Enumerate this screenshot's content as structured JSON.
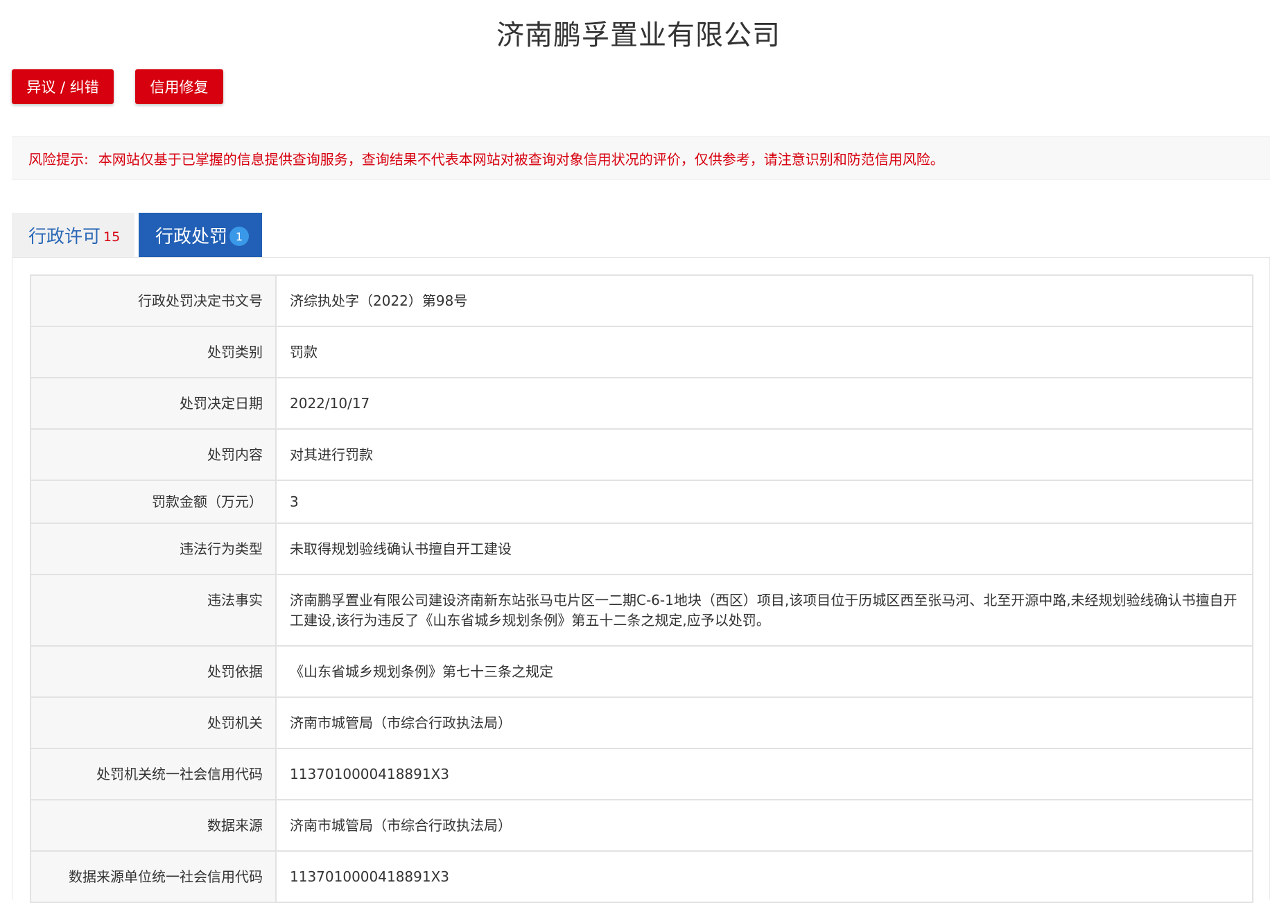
{
  "page": {
    "title": "济南鹏孚置业有限公司"
  },
  "actions": {
    "dispute_label": "异议 / 纠错",
    "repair_label": "信用修复"
  },
  "risk": {
    "label": "风险提示:",
    "text": "本网站仅基于已掌握的信息提供查询服务，查询结果不代表本网站对被查询对象信用状况的评价，仅供参考，请注意识别和防范信用风险。"
  },
  "tabs": [
    {
      "label": "行政许可",
      "count": "15",
      "active": false
    },
    {
      "label": "行政处罚",
      "count": "1",
      "active": true
    }
  ],
  "record": [
    {
      "key": "行政处罚决定书文号",
      "value": "济综执处字（2022）第98号"
    },
    {
      "key": "处罚类别",
      "value": "罚款"
    },
    {
      "key": "处罚决定日期",
      "value": "2022/10/17"
    },
    {
      "key": "处罚内容",
      "value": "对其进行罚款"
    },
    {
      "key": "罚款金额（万元）",
      "value": "3"
    },
    {
      "key": "违法行为类型",
      "value": "未取得规划验线确认书擅自开工建设"
    },
    {
      "key": "违法事实",
      "value": "济南鹏孚置业有限公司建设济南新东站张马屯片区一二期C-6-1地块（西区）项目,该项目位于历城区西至张马河、北至开源中路,未经规划验线确认书擅自开工建设,该行为违反了《山东省城乡规划条例》第五十二条之规定,应予以处罚。"
    },
    {
      "key": "处罚依据",
      "value": "《山东省城乡规划条例》第七十三条之规定"
    },
    {
      "key": "处罚机关",
      "value": "济南市城管局（市综合行政执法局）"
    },
    {
      "key": "处罚机关统一社会信用代码",
      "value": "1137010000418891X3"
    },
    {
      "key": "数据来源",
      "value": "济南市城管局（市综合行政执法局）"
    },
    {
      "key": "数据来源单位统一社会信用代码",
      "value": "1137010000418891X3"
    }
  ],
  "colors": {
    "accent_red": "#d7000f",
    "tab_active_blue": "#2160b6",
    "badge_blue": "#3a98e8"
  }
}
